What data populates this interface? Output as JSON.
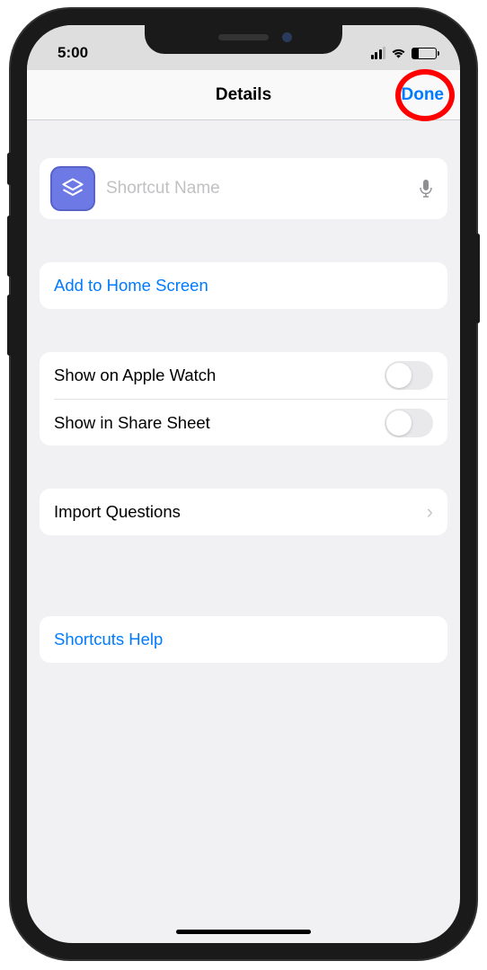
{
  "status": {
    "time": "5:00"
  },
  "header": {
    "title": "Details",
    "done_label": "Done"
  },
  "name_field": {
    "placeholder": "Shortcut Name",
    "value": ""
  },
  "actions": {
    "add_home_label": "Add to Home Screen"
  },
  "toggles": {
    "apple_watch_label": "Show on Apple Watch",
    "apple_watch_on": false,
    "share_sheet_label": "Show in Share Sheet",
    "share_sheet_on": false
  },
  "import": {
    "label": "Import Questions"
  },
  "help": {
    "label": "Shortcuts Help"
  }
}
